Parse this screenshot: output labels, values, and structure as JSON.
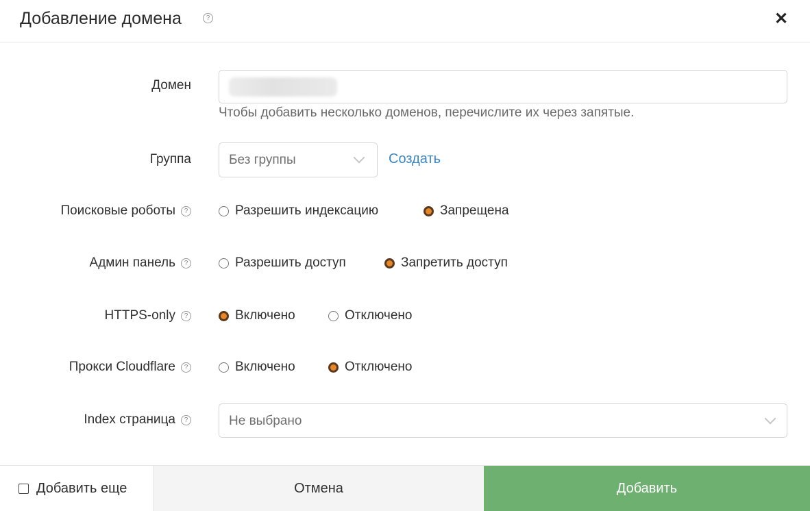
{
  "dialog": {
    "title": "Добавление домена",
    "help_glyph": "?",
    "close_glyph": "✕"
  },
  "form": {
    "domain": {
      "label": "Домен",
      "value": "",
      "hint": "Чтобы добавить несколько доменов, перечислите их через запятые."
    },
    "group": {
      "label": "Группа",
      "selected": "Без группы",
      "create_link": "Создать"
    },
    "robots": {
      "label": "Поисковые роботы",
      "options": [
        "Разрешить индексацию",
        "Запрещена"
      ],
      "selected_index": 1
    },
    "admin": {
      "label": "Админ панель",
      "options": [
        "Разрешить доступ",
        "Запретить доступ"
      ],
      "selected_index": 1
    },
    "https": {
      "label": "HTTPS-only",
      "options": [
        "Включено",
        "Отключено"
      ],
      "selected_index": 0
    },
    "cloudflare": {
      "label": "Прокси Cloudflare",
      "options": [
        "Включено",
        "Отключено"
      ],
      "selected_index": 1
    },
    "index_page": {
      "label": "Index страница",
      "selected": "Не выбрано"
    }
  },
  "footer": {
    "add_more_label": "Добавить еще",
    "add_more_checked": false,
    "cancel_label": "Отмена",
    "submit_label": "Добавить"
  },
  "colors": {
    "accent_radio": "#e8862a",
    "submit_bg": "#6db070",
    "link": "#3b86c4"
  }
}
